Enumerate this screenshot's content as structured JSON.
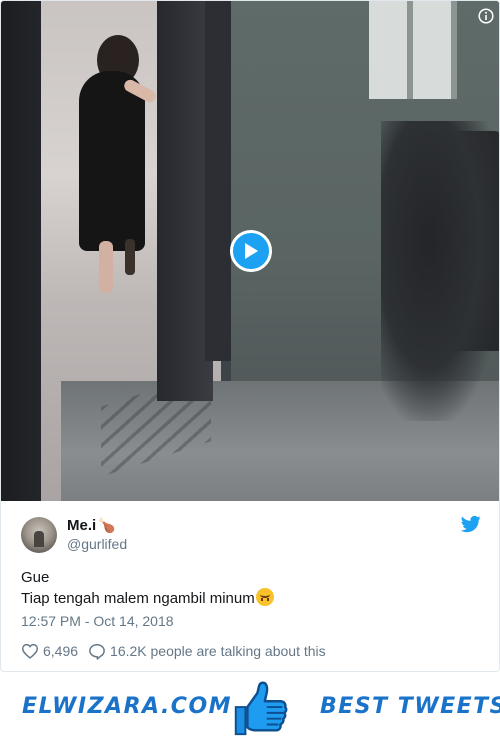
{
  "tweet": {
    "author": {
      "display_name": "Me.i",
      "name_emoji": "🍗",
      "handle": "@gurlifed"
    },
    "text_lines": [
      "Gue",
      "Tiap tengah malem ngambil minum"
    ],
    "text_emoji": "upside-down-face-emoji",
    "timestamp": "12:57 PM - Oct 14, 2018",
    "likes": "6,496",
    "conversation": "16.2K people are talking about this"
  },
  "video": {
    "play_icon": "play-icon",
    "info_icon": "info-icon"
  },
  "footer": {
    "left_text": "ELWIZARA.COM",
    "right_text": "BEST TWEETS",
    "thumb_icon": "thumbs-up-icon"
  },
  "colors": {
    "twitter_blue": "#1da1f2",
    "footer_blue": "#1a73c9",
    "text_primary": "#14171a",
    "text_secondary": "#657786",
    "border": "#e1e8ed"
  }
}
